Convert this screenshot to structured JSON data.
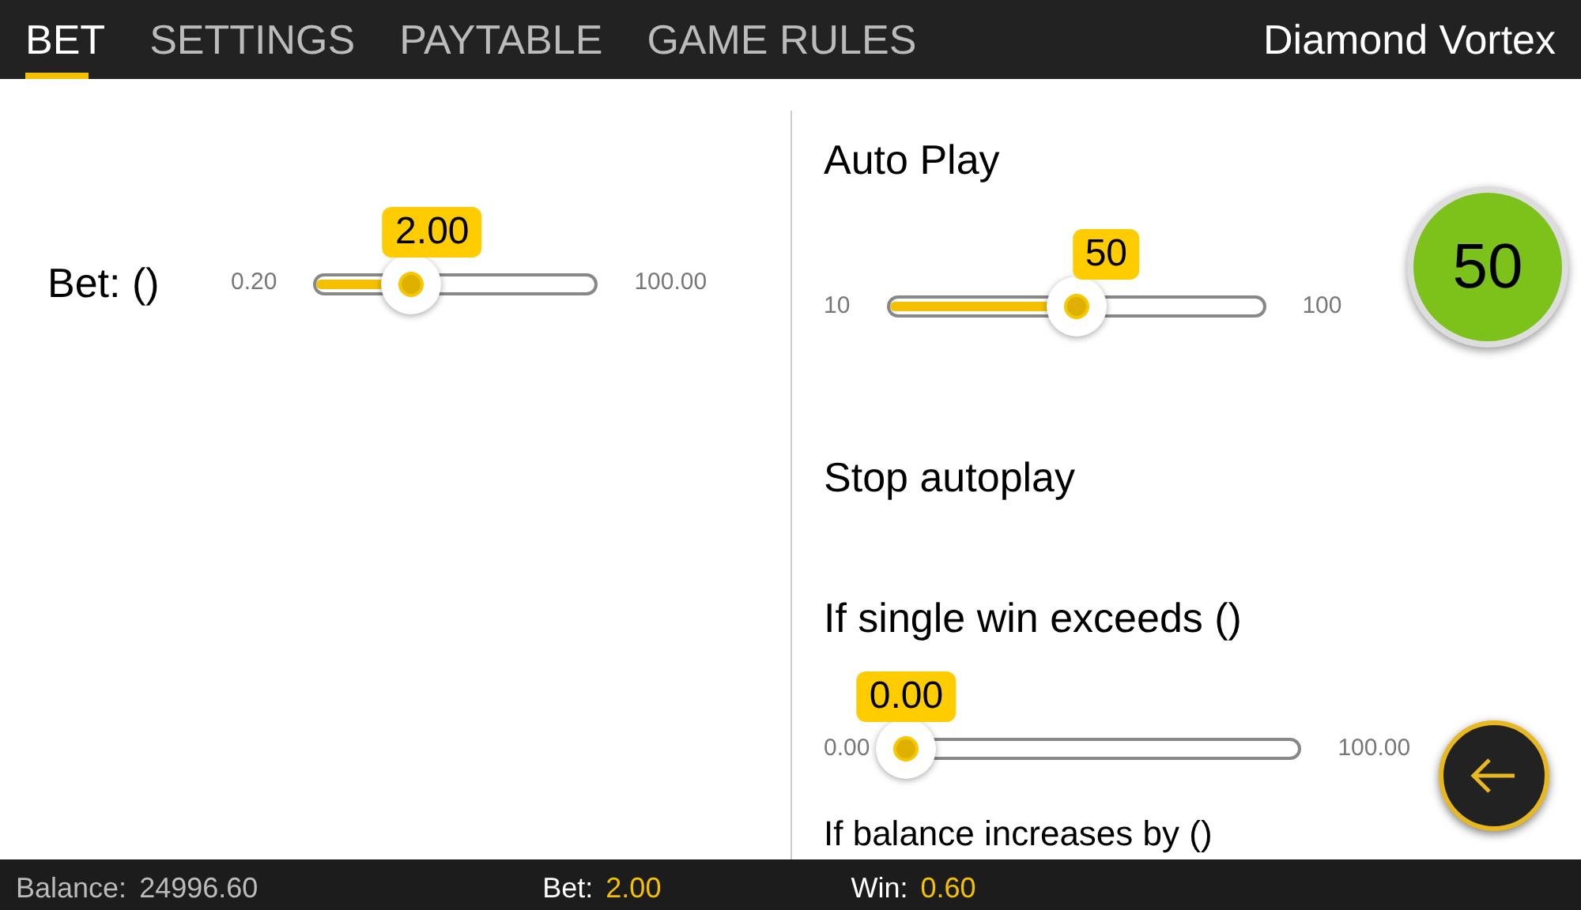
{
  "tabs": [
    {
      "label": "BET",
      "selected": true
    },
    {
      "label": "SETTINGS",
      "selected": false
    },
    {
      "label": "PAYTABLE",
      "selected": false
    },
    {
      "label": "GAME RULES",
      "selected": false
    }
  ],
  "game_title": "Diamond Vortex",
  "bet_slider": {
    "label": "Bet: ()",
    "min": "0.20",
    "max": "100.00",
    "value": "2.00",
    "level": 0.345
  },
  "auto_play": {
    "title": "Auto Play",
    "min": "10",
    "max": "100",
    "value": "50",
    "level": 0.5,
    "play_button": "50"
  },
  "stop_autoplay": {
    "title": "Stop autoplay",
    "single_win": {
      "label": "If single win exceeds ()",
      "min": "0.00",
      "max": "100.00",
      "value": "0.00",
      "level": 0
    },
    "balance_label": "If balance increases by ()"
  },
  "status_bar": {
    "balance_label": "Balance:",
    "balance": "24996.60",
    "bet_label": "Bet:",
    "bet": "2.00",
    "win_label": "Win:",
    "win": "0.60"
  }
}
